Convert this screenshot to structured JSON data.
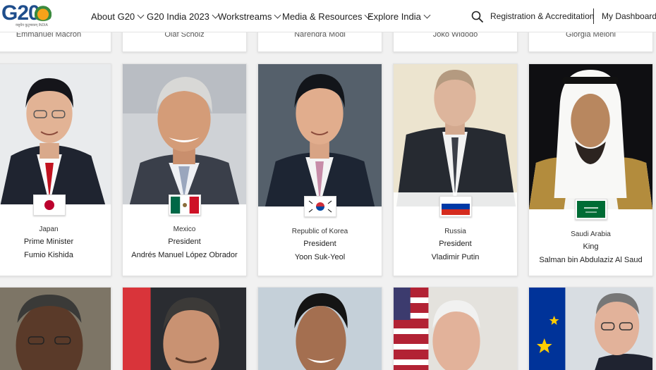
{
  "header": {
    "logo_text": "G20",
    "logo_tagline": "वसुधैव कुटुम्बकम् INDIA",
    "nav": [
      "About G20",
      "G20 India 2023",
      "Workstreams",
      "Media & Resources",
      "Explore India"
    ],
    "registration_label": "Registration & Accreditation",
    "dashboard_label": "My Dashboard"
  },
  "top_row": [
    "Emmanuel Macron",
    "Olaf Scholz",
    "Narendra Modi",
    "Joko Widodo",
    "Giorgia Meloni"
  ],
  "leaders": [
    {
      "country": "Japan",
      "role": "Prime Minister",
      "name": "Fumio Kishida"
    },
    {
      "country": "Mexico",
      "role": "President",
      "name": "Andrés Manuel López Obrador"
    },
    {
      "country": "Republic of Korea",
      "role": "President",
      "name": "Yoon Suk-Yeol"
    },
    {
      "country": "Russia",
      "role": "President",
      "name": "Vladimir Putin"
    },
    {
      "country": "Saudi Arabia",
      "role": "King",
      "name": "Salman bin Abdulaziz Al Saud"
    }
  ],
  "colors": {
    "nav_text": "#222222",
    "card_bg": "#ffffff",
    "page_bg": "#f1f1f1",
    "logo_blue": "#1f4e8c"
  }
}
